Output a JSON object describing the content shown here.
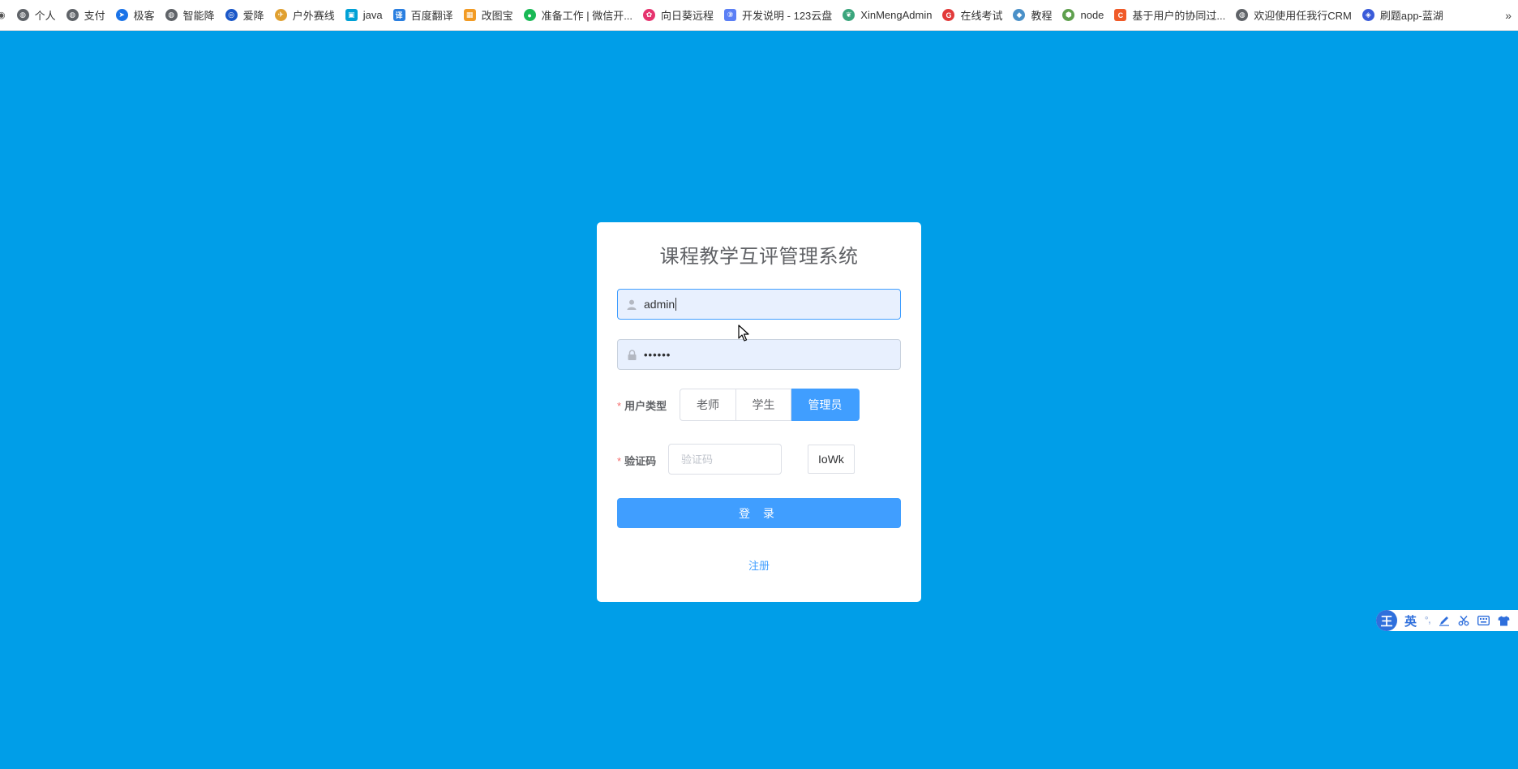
{
  "bookmarks": [
    {
      "label": "个人",
      "icon": "globe-icon",
      "color": "#5f6368"
    },
    {
      "label": "支付",
      "icon": "globe-icon",
      "color": "#5f6368"
    },
    {
      "label": "极客",
      "icon": "paper-plane-icon",
      "color": "#1a73e8"
    },
    {
      "label": "智能降",
      "icon": "globe-icon",
      "color": "#5f6368"
    },
    {
      "label": "爱降",
      "icon": "swirl-icon",
      "color": "#1a57c8"
    },
    {
      "label": "户外赛线",
      "icon": "rocket-icon",
      "color": "#e0a030"
    },
    {
      "label": "java",
      "icon": "tv-icon",
      "color": "#00a1d6"
    },
    {
      "label": "百度翻译",
      "icon": "translate-icon",
      "color": "#2a7fe0"
    },
    {
      "label": "改图宝",
      "icon": "image-icon",
      "color": "#f29b24"
    },
    {
      "label": "准备工作 | 微信开...",
      "icon": "wechat-icon",
      "color": "#19b955"
    },
    {
      "label": "向日葵远程",
      "icon": "sunflower-icon",
      "color": "#e6336e"
    },
    {
      "label": "开发说明 - 123云盘",
      "icon": "cloud-123-icon",
      "color": "#5b7ff5"
    },
    {
      "label": "XinMengAdmin",
      "icon": "leaf-icon",
      "color": "#3aa57c"
    },
    {
      "label": "在线考试",
      "icon": "exam-icon",
      "color": "#e23b3b"
    },
    {
      "label": "教程",
      "icon": "shield-icon",
      "color": "#4a90c8"
    },
    {
      "label": "node",
      "icon": "node-icon",
      "color": "#5fa04e"
    },
    {
      "label": "基于用户的协同过...",
      "icon": "c-icon",
      "color": "#f05a28"
    },
    {
      "label": "欢迎使用任我行CRM",
      "icon": "globe-icon",
      "color": "#5f6368"
    },
    {
      "label": "刷题app-蓝湖",
      "icon": "lanhu-icon",
      "color": "#3a5bd9"
    }
  ],
  "bookmarks_more": "»",
  "login": {
    "title": "课程教学互评管理系统",
    "username_value": "admin",
    "password_masked": "••••••",
    "user_type_label": "用户类型",
    "required_mark": "*",
    "user_types": [
      "老师",
      "学生",
      "管理员"
    ],
    "selected_user_type": "管理员",
    "captcha_label": "验证码",
    "captcha_placeholder": "验证码",
    "captcha_code": "IoWk",
    "login_button": "登 录",
    "register_link": "注册"
  },
  "ime": {
    "logo": "王",
    "mode": "英",
    "punct": "°,"
  },
  "colors": {
    "background": "#009ee8",
    "primary": "#409eff",
    "required": "#f56c6c"
  }
}
